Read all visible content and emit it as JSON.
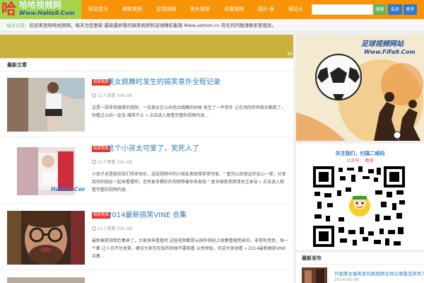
{
  "header": {
    "logo_glyph": "哈",
    "logo_cn": "哈哈视频网",
    "logo_url": "Www.HaHa9.Com",
    "nav": [
      "网站首页",
      "搞笑视频",
      "足球视频",
      "美女视频",
      "动漫视频",
      "国外·泰",
      "网站头"
    ],
    "search_placeholder": "",
    "search_button": "搜索",
    "member_button": "会员",
    "dropdown_button": "更多"
  },
  "notice": {
    "label": "站点公告：",
    "text": "欢迎来到哈哈视频网，每天为您更新 最新最好看的搞笑视频和足球精彩集锦 Www.admon.cn 有任何问题请联系管理员。"
  },
  "banner": {
    "number": "99"
  },
  "main": {
    "section_title": "最新文章",
    "articles": [
      {
        "category": "搞笑视频",
        "title": "美女跳舞时发生的搞笑意外全程记录",
        "views": "12人观看",
        "date": "(06-18)",
        "desc": "这是一段非常搞笑的视频，一位美女在公共场合跳舞的时候 发生了一件意外 让在场的所有观众都笑了，你看过以后一定会 爆笑不止 » 点击进入观看完整的视频内容…"
      },
      {
        "category": "搞笑视频",
        "title": "这个小孩太可爱了，笑死人了",
        "views": "12人观看",
        "date": "(06-18)",
        "desc": "小孩子总是能给我们带来快乐，这段视频中的小朋友表现得非常可爱，\" 看完以后保证你会心一笑，分享给你的朋友一起来看看吧，还有更多精彩的视频等着你来发现 \" 更多搞笑视频请关注本站 » 点击进入观看完整的视频内容…"
      },
      {
        "category": "搞笑视频",
        "title": "2014最新搞笑VINE 合集",
        "views": "12人观看",
        "date": "(06-18)",
        "desc": "最新搞笑视频合集来了，大家快来看看吧 这些视频都是从国外网站上收集整理而来的，非常有意思，每一个都 让人忍不住发笑，建议大家在吃饭的时候不要观看 以免喷饭，欢迎大家收看 » 2014最新搞笑VINE 合集…"
      }
    ]
  },
  "sidebar": {
    "promo_title": "足球视频网站",
    "promo_url": "Www.FiFa9.Com",
    "qr_line1": "关注我们，扫描二维码",
    "qr_line2": "公众号：  跑捏",
    "new_title": "最新发布",
    "new_link": "外国美女搞笑恶作剧视频全程记录看完笑死人",
    "new_date": "2014-05-06"
  }
}
